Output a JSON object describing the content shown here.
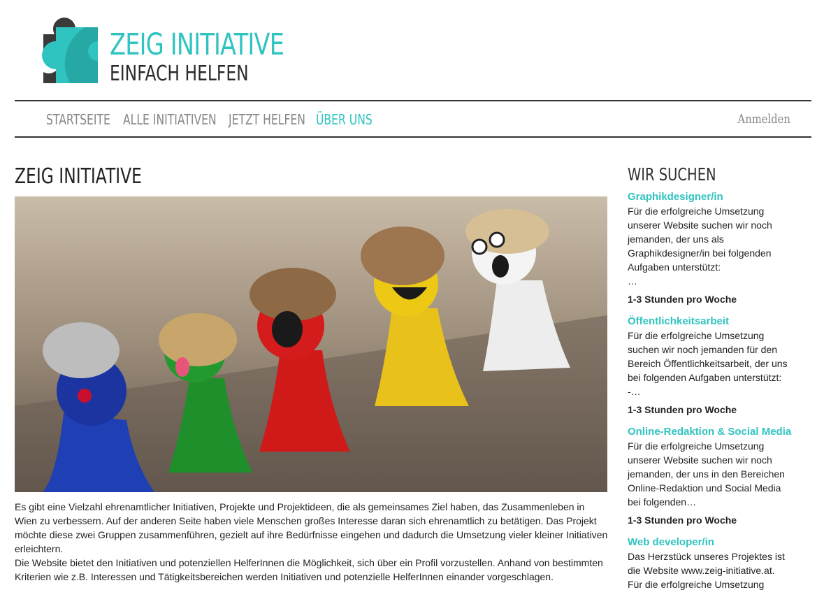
{
  "logo": {
    "title": "ZEIG INITIATIVE",
    "subtitle": "EINFACH HELFEN",
    "icon": "puzzle-piece-icon",
    "colors": {
      "accent": "#2fc4c0",
      "dark": "#3a3a3a"
    }
  },
  "nav": {
    "items": [
      {
        "label": "STARTSEITE"
      },
      {
        "label": "ALLE INITIATIVEN"
      },
      {
        "label": "JETZT HELFEN"
      },
      {
        "label": "ÜBER UNS",
        "active": true
      }
    ],
    "login": "Anmelden"
  },
  "main": {
    "title": "ZEIG INITIATIVE",
    "paragraph1": "Es gibt eine Vielzahl ehrenamtlicher Initiativen, Projekte und Projektideen, die als gemeinsames Ziel haben, das Zusammenleben in Wien zu verbessern. Auf der anderen Seite haben viele Menschen großes Interesse daran sich ehrenamtlich zu betätigen. Das Projekt möchte diese zwei Gruppen zusammenführen, gezielt auf ihre Bedürfnisse eingehen und dadurch die Umsetzung vieler kleiner Initiativen erleichtern.",
    "paragraph2": "Die Website bietet den Initiativen und potenziellen HelferInnen die Möglichkeit, sich über ein Profil vorzustellen. Anhand von bestimmten Kriterien wie z.B. Interessen und Tätigkeitsbereichen werden Initiativen und potenzielle HelferInnen einander vorgeschlagen."
  },
  "sidebar": {
    "title": "WIR SUCHEN",
    "jobs": [
      {
        "title": "Graphikdesigner/in",
        "text": "Für die erfolgreiche Umsetzung\nunserer Website suchen wir noch\njemanden, der uns als\nGraphikdesigner/in bei folgenden\nAufgaben unterstützt:\n…",
        "hours": "1-3 Stunden pro Woche"
      },
      {
        "title": "Öffentlichkeitsarbeit",
        "text": "Für die erfolgreiche Umsetzung\nsuchen wir noch jemanden für den\nBereich Öffentlichkeitsarbeit, der uns\nbei folgenden Aufgaben unterstützt:\n-…",
        "hours": "1-3 Stunden pro Woche"
      },
      {
        "title": "Online-Redaktion & Social Media",
        "text": "Für die erfolgreiche Umsetzung\nunserer Website suchen wir noch\njemanden, der uns in den Bereichen\nOnline-Redaktion und Social Media\nbei folgenden…",
        "hours": "1-3 Stunden pro Woche"
      },
      {
        "title": "Web developer/in",
        "text": "Das Herzstück unseres Projektes ist\ndie Website www.zeig-initiative.at.\nFür die erfolgreiche Umsetzung",
        "hours": ""
      }
    ]
  }
}
